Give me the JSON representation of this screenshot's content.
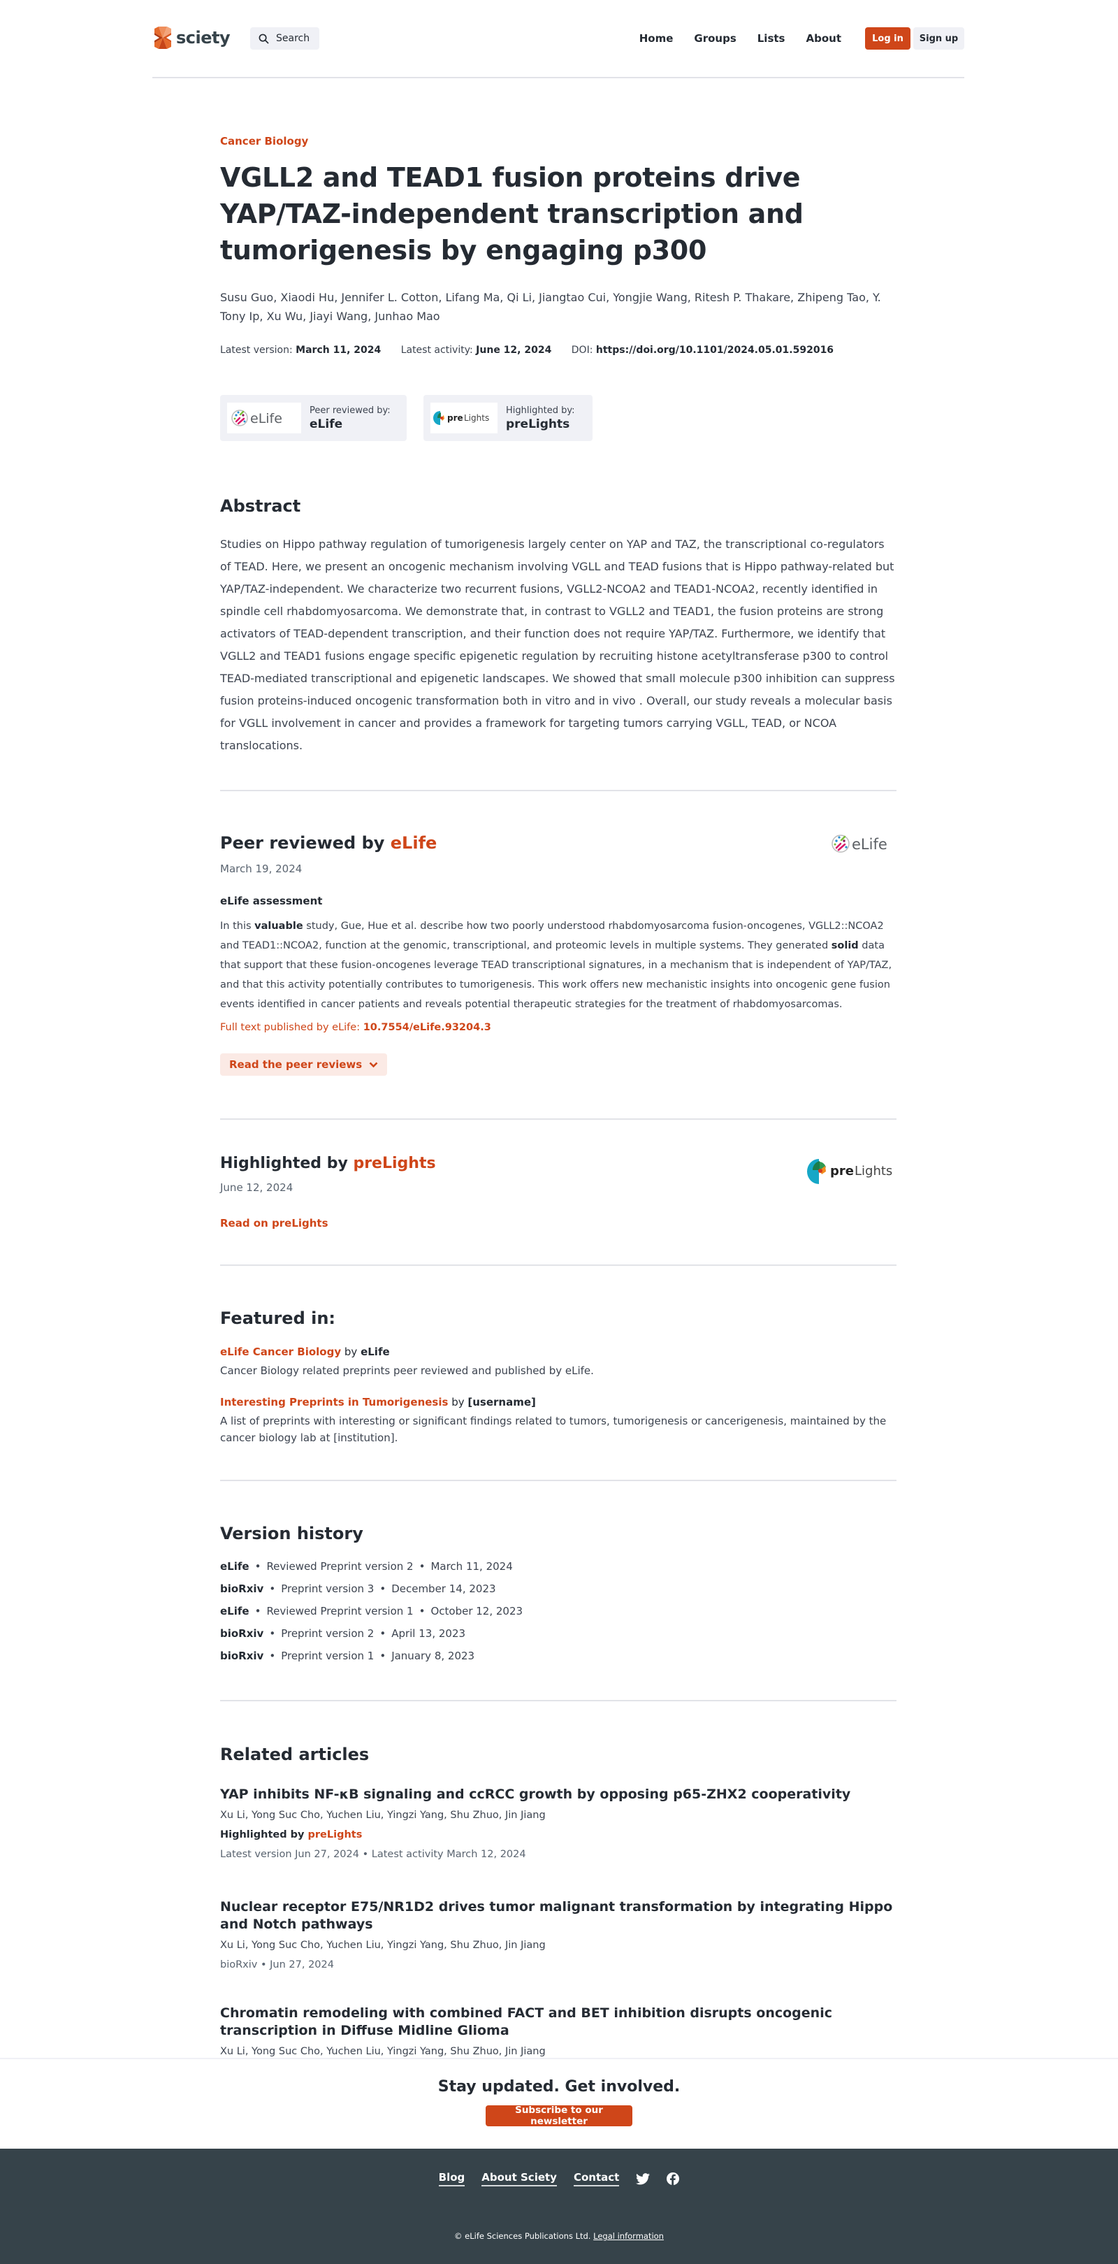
{
  "header": {
    "logo_text": "sciety",
    "search_label": "Search",
    "nav": [
      "Home",
      "Groups",
      "Lists",
      "About"
    ],
    "login_label": "Log in",
    "signup_label": "Sign up"
  },
  "article": {
    "category": "Cancer Biology",
    "title": "VGLL2 and TEAD1 fusion proteins drive YAP/TAZ-independent transcription and tumorigenesis by engaging p300",
    "authors": "Susu Guo, Xiaodi Hu, Jennifer L. Cotton, Lifang Ma, Qi Li, Jiangtao Cui, Yongjie Wang, Ritesh P. Thakare, Zhipeng Tao, Y. Tony Ip, Xu Wu, Jiayi Wang, Junhao Mao",
    "latest_version_label": "Latest version:",
    "latest_version": "March 11, 2024",
    "latest_activity_label": "Latest activity:",
    "latest_activity": "June 12, 2024",
    "doi_label": "DOI:",
    "doi": "https://doi.org/10.1101/2024.05.01.592016"
  },
  "badges": [
    {
      "logo": "eLife",
      "label": "Peer reviewed by:",
      "name": "eLife"
    },
    {
      "logo": "preLights",
      "label": "Highlighted by:",
      "name": "preLights"
    }
  ],
  "abstract": {
    "heading": "Abstract",
    "text": "Studies on Hippo pathway regulation of tumorigenesis largely center on YAP and TAZ, the transcriptional co-regulators of TEAD. Here, we present an oncogenic mechanism involving VGLL and TEAD fusions that is Hippo pathway-related but YAP/TAZ-independent. We characterize two recurrent fusions, VGLL2-NCOA2 and TEAD1-NCOA2, recently identified in spindle cell rhabdomyosarcoma. We demonstrate that, in contrast to VGLL2 and TEAD1, the fusion proteins are strong activators of TEAD-dependent transcription, and their function does not require YAP/TAZ. Furthermore, we identify that VGLL2 and TEAD1 fusions engage specific epigenetic regulation by recruiting histone acetyltransferase p300 to control TEAD-mediated transcriptional and epigenetic landscapes. We showed that small molecule p300 inhibition can suppress fusion proteins-induced oncogenic transformation both in vitro and in vivo . Overall, our study reveals a molecular basis for VGLL involvement in cancer and provides a framework for targeting tumors carrying VGLL, TEAD, or NCOA translocations."
  },
  "peer_review": {
    "heading_prefix": "Peer reviewed by ",
    "group": "eLife",
    "logo": "eLife",
    "date": "March 19, 2024",
    "assessment_heading": "eLife assessment",
    "assessment_parts": [
      "In this ",
      "valuable",
      " study, Gue, Hue et al. describe how two poorly understood rhabdomyosarcoma fusion-oncogenes, VGLL2::NCOA2 and TEAD1::NCOA2, function at the genomic, transcriptional, and proteomic levels in multiple systems. They generated ",
      "solid",
      " data that support that these fusion-oncogenes leverage TEAD transcriptional signatures, in a mechanism that is independent of YAP/TAZ, and that this activity potentially contributes to tumorigenesis. This work offers new mechanistic insights into oncogenic gene fusion events identified in cancer patients and reveals potential therapeutic strategies for the treatment of rhabdomyosarcomas."
    ],
    "fulltext_label": "Full text published by eLife: ",
    "fulltext_doi": "10.7554/eLife.93204.3",
    "read_reviews_label": "Read the peer reviews"
  },
  "highlight": {
    "heading_prefix": "Highlighted by ",
    "group": "preLights",
    "logo": "preLights",
    "date": "June 12, 2024",
    "read_label": "Read on preLights"
  },
  "featured": {
    "heading": "Featured in:",
    "items": [
      {
        "list": "eLife Cancer Biology",
        "by": " by ",
        "owner": "eLife",
        "description": "Cancer Biology related preprints peer reviewed and published by eLife."
      },
      {
        "list": "Interesting Preprints in Tumorigenesis",
        "by": " by ",
        "owner": "[username]",
        "description": "A list of preprints with interesting or significant findings related to tumors, tumorigenesis or cancerigenesis, maintained by the cancer biology lab at [institution]."
      }
    ]
  },
  "version_history": {
    "heading": "Version history",
    "items": [
      {
        "server": "eLife",
        "version": "Reviewed Preprint version 2",
        "date": "March 11, 2024"
      },
      {
        "server": "bioRxiv",
        "version": "Preprint version 3",
        "date": "December 14, 2023"
      },
      {
        "server": "eLife",
        "version": "Reviewed Preprint version 1",
        "date": "October 12, 2023"
      },
      {
        "server": "bioRxiv",
        "version": "Preprint version 2",
        "date": "April 13, 2023"
      },
      {
        "server": "bioRxiv",
        "version": "Preprint version 1",
        "date": "January 8, 2023"
      }
    ]
  },
  "related": {
    "heading": "Related articles",
    "items": [
      {
        "title": "YAP inhibits NF-κB signaling and ccRCC growth by opposing p65-ZHX2 cooperativity",
        "authors": "Xu Li, Yong Suc Cho, Yuchen Liu, Yingzi Yang, Shu Zhuo, Jin Jiang",
        "highlight_prefix": "Highlighted by ",
        "highlight_group": "preLights",
        "meta": "Latest version Jun 27, 2024  •  Latest activity March 12, 2024"
      },
      {
        "title": "Nuclear receptor E75/NR1D2 drives tumor malignant transformation by integrating Hippo and Notch pathways",
        "authors": "Xu Li, Yong Suc Cho, Yuchen Liu, Yingzi Yang, Shu Zhuo, Jin Jiang",
        "meta": "bioRxiv  •   Jun 27, 2024"
      },
      {
        "title": "Chromatin remodeling with combined FACT and BET inhibition disrupts oncogenic transcription in Diffuse Midline Glioma",
        "authors": "Xu Li, Yong Suc Cho, Yuchen Liu, Yingzi Yang, Shu Zhuo, Jin Jiang"
      }
    ]
  },
  "newsletter": {
    "title": "Stay updated. Get involved.",
    "button": "Subscribe to our newsletter"
  },
  "footer": {
    "links": [
      "Blog",
      "About Sciety",
      "Contact"
    ],
    "social": [
      "twitter-icon",
      "facebook-icon"
    ],
    "copyright": "© eLife Sciences Publications Ltd. ",
    "legal": "Legal information"
  },
  "colors": {
    "accent": "#cf4619",
    "text": "#252b33",
    "footer_bg": "#36434a",
    "chip_bg": "#f0f1f6"
  }
}
